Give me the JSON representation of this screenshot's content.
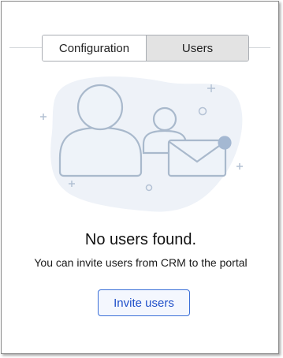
{
  "tabs": [
    {
      "label": "Configuration",
      "selected": false
    },
    {
      "label": "Users",
      "selected": true
    }
  ],
  "illustration": {
    "icons": [
      "user-large-icon",
      "user-small-icon",
      "envelope-icon",
      "sparkle-plus-icon",
      "sparkle-circle-icon"
    ]
  },
  "empty_state": {
    "title": "No users found.",
    "description": "You can invite users from CRM to the portal",
    "button_label": "Invite users"
  },
  "colors": {
    "accent": "#1f4fc9",
    "selected_tab_bg": "#e3e3e3",
    "illustration_stroke": "#a9b9cc",
    "illustration_fill": "#eef2f8"
  }
}
